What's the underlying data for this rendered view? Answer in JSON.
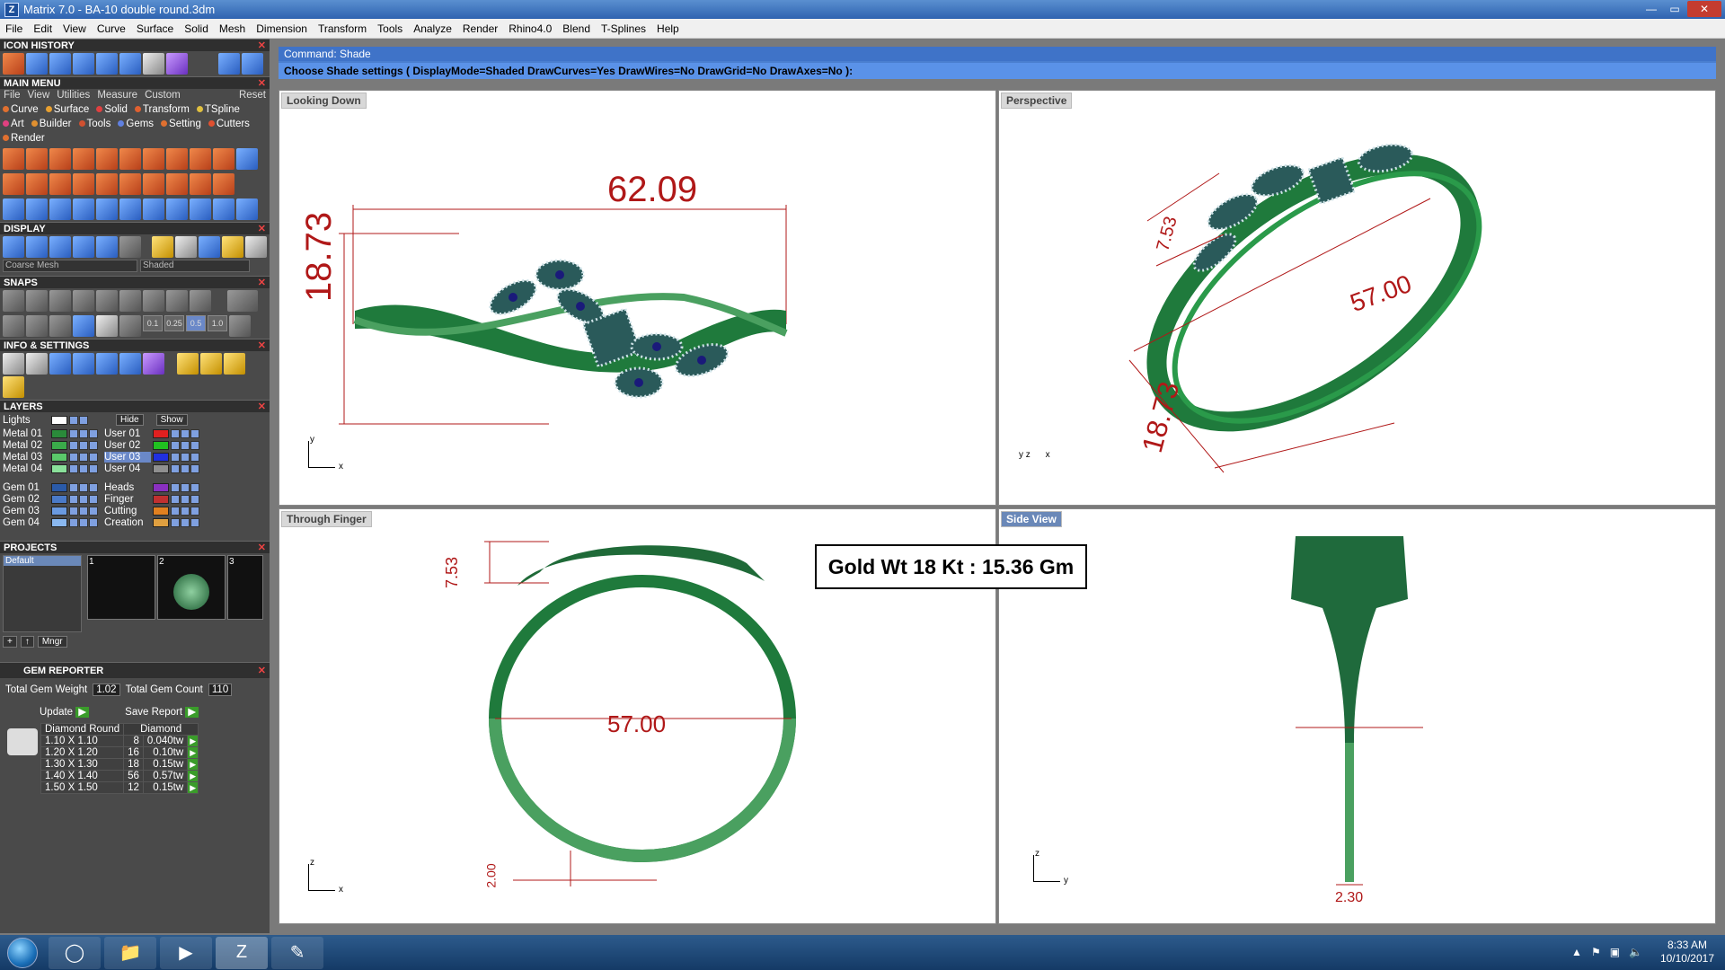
{
  "window": {
    "title": "Matrix 7.0 - BA-10 double round.3dm",
    "app_icon": "Z"
  },
  "menubar": [
    "File",
    "Edit",
    "View",
    "Curve",
    "Surface",
    "Solid",
    "Mesh",
    "Dimension",
    "Transform",
    "Tools",
    "Analyze",
    "Render",
    "Rhino4.0",
    "Blend",
    "T-Splines",
    "Help"
  ],
  "left": {
    "icon_history": "ICON HISTORY",
    "main_menu": "MAIN MENU",
    "main_menu_items": [
      "File",
      "View",
      "Utilities",
      "Measure",
      "Custom"
    ],
    "main_menu_reset": "Reset",
    "categories": [
      {
        "label": "Curve",
        "color": "#e07030"
      },
      {
        "label": "Surface",
        "color": "#e8a030"
      },
      {
        "label": "Solid",
        "color": "#e04040"
      },
      {
        "label": "Transform",
        "color": "#e06030"
      },
      {
        "label": "TSpline",
        "color": "#e0c040"
      },
      {
        "label": "Art",
        "color": "#e04080"
      },
      {
        "label": "Builder",
        "color": "#e09030"
      },
      {
        "label": "Tools",
        "color": "#d05030"
      },
      {
        "label": "Gems",
        "color": "#6080e0"
      },
      {
        "label": "Setting",
        "color": "#e07030"
      },
      {
        "label": "Cutters",
        "color": "#e05030"
      },
      {
        "label": "Render",
        "color": "#e07030"
      }
    ],
    "display": "DISPLAY",
    "display_mesh": "Coarse Mesh",
    "display_mode": "Shaded",
    "snaps": "SNAPS",
    "snap_values": [
      "0.1",
      "0.25",
      "0.5",
      "1.0"
    ],
    "info_settings": "INFO & SETTINGS",
    "layers": "LAYERS",
    "layers_lights": "Lights",
    "layers_hide": "Hide",
    "layers_show": "Show",
    "layer_left": [
      {
        "name": "Metal 01",
        "color": "#2a8a3a"
      },
      {
        "name": "Metal 02",
        "color": "#3aaa4a"
      },
      {
        "name": "Metal 03",
        "color": "#5ac86a"
      },
      {
        "name": "Metal 04",
        "color": "#8ae09a"
      },
      {
        "name": "Gem 01",
        "color": "#2a5aa8"
      },
      {
        "name": "Gem 02",
        "color": "#4a7ac8"
      },
      {
        "name": "Gem 03",
        "color": "#6a9ae0"
      },
      {
        "name": "Gem 04",
        "color": "#8ab8f0"
      }
    ],
    "layer_right": [
      {
        "name": "User 01",
        "color": "#e02020"
      },
      {
        "name": "User 02",
        "color": "#20c020"
      },
      {
        "name": "User 03",
        "color": "#2030e0"
      },
      {
        "name": "User 04",
        "color": "#909090"
      },
      {
        "name": "Heads",
        "color": "#8a30c0"
      },
      {
        "name": "Finger",
        "color": "#c03030"
      },
      {
        "name": "Cutting",
        "color": "#e08020"
      },
      {
        "name": "Creation",
        "color": "#e0a040"
      }
    ],
    "projects": "PROJECTS",
    "project_default": "Default",
    "project_thumbs": [
      "1",
      "2",
      "3"
    ],
    "project_mngr": "Mngr",
    "gem_reporter": "GEM REPORTER",
    "total_gem_weight_label": "Total Gem Weight",
    "total_gem_weight": "1.02",
    "total_gem_count_label": "Total Gem Count",
    "total_gem_count": "110",
    "update": "Update",
    "save_report": "Save Report",
    "gem_headers": [
      "Diamond Round",
      "Diamond"
    ],
    "gem_rows": [
      {
        "size": "1.10 X 1.10",
        "count": "8",
        "wt": "0.040tw"
      },
      {
        "size": "1.20 X 1.20",
        "count": "16",
        "wt": "0.10tw"
      },
      {
        "size": "1.30 X 1.30",
        "count": "18",
        "wt": "0.15tw"
      },
      {
        "size": "1.40 X 1.40",
        "count": "56",
        "wt": "0.57tw"
      },
      {
        "size": "1.50 X 1.50",
        "count": "12",
        "wt": "0.15tw"
      }
    ]
  },
  "command": {
    "line": "Command: Shade",
    "prompt": "Choose Shade settings ( DisplayMode=Shaded  DrawCurves=Yes  DrawWires=No  DrawGrid=No  DrawAxes=No ):"
  },
  "viewports": {
    "top": {
      "label": "Looking Down",
      "width_dim": "62.09",
      "height_dim": "18.73",
      "axis_y": "y",
      "axis_x": "x"
    },
    "persp": {
      "label": "Perspective",
      "dim_a": "7.53",
      "dim_b": "57.00",
      "dim_c": "18.73",
      "axis_y": "y",
      "axis_z": "z",
      "axis_x": "x"
    },
    "front": {
      "label": "Through Finger",
      "dim_top": "7.53",
      "diameter": "57.00",
      "dim_bottom": "2.00",
      "axis_z": "z",
      "axis_x": "x"
    },
    "side": {
      "label": "Side View",
      "dim_width": "2.30",
      "axis_z": "z",
      "axis_y": "y"
    }
  },
  "gold_weight": "Gold Wt 18 Kt : 15.36 Gm",
  "taskbar": {
    "time": "8:33 AM",
    "date": "10/10/2017"
  }
}
